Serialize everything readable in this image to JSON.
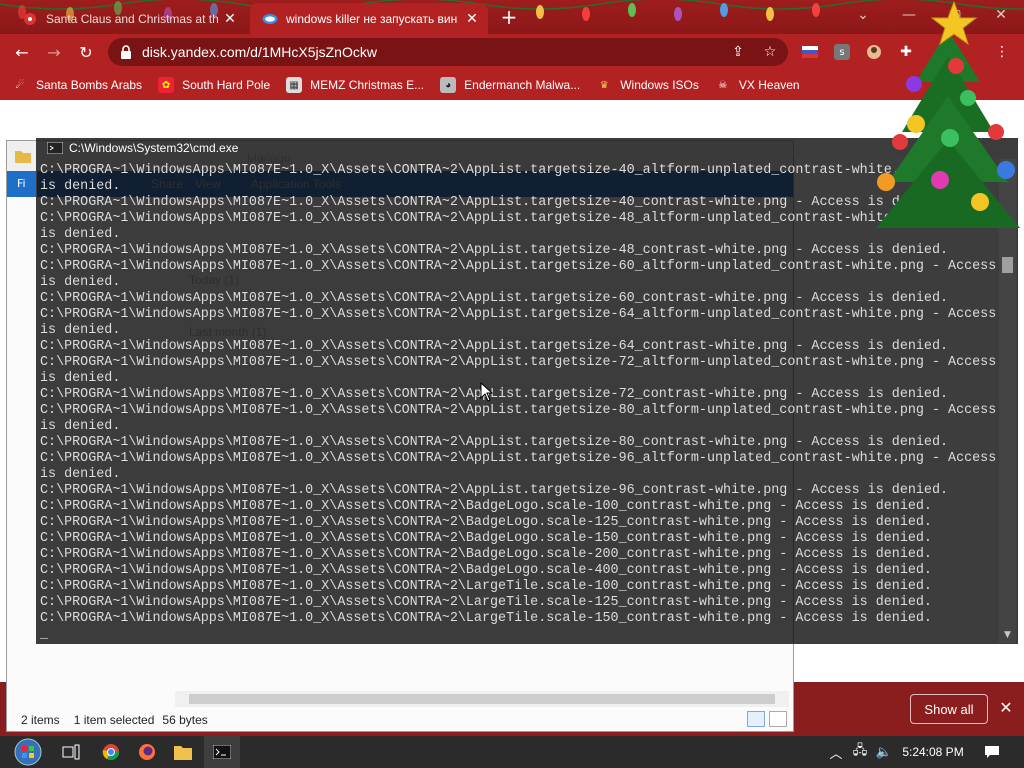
{
  "browser": {
    "tabs": [
      {
        "title": "Santa Claus and Christmas at th",
        "favicon": "christmas-icon"
      },
      {
        "title": "windows killer не запускать вин",
        "favicon": "disk-icon"
      }
    ],
    "active_tab": 1,
    "url": "disk.yandex.com/d/1MHcX5jsZnOckw",
    "bookmarks": [
      {
        "label": "Santa Bombs Arabs"
      },
      {
        "label": "South Hard Pole"
      },
      {
        "label": "MEMZ Christmas E..."
      },
      {
        "label": "Endermanch Malwa..."
      },
      {
        "label": "Windows ISOs"
      },
      {
        "label": "VX Heaven"
      }
    ],
    "extension_badge": "s",
    "download_bar": {
      "show_all": "Show all"
    }
  },
  "explorer": {
    "status": {
      "items": "2 items",
      "selected": "1 item selected",
      "size": "56 bytes"
    }
  },
  "cmd": {
    "title": "C:\\Windows\\System32\\cmd.exe",
    "lines": [
      "C:\\PROGRA~1\\WindowsApps\\MI087E~1.0_X\\Assets\\CONTRA~2\\AppList.targetsize-40_altform-unplated_contrast-white.png - Access",
      "is denied.",
      "C:\\PROGRA~1\\WindowsApps\\MI087E~1.0_X\\Assets\\CONTRA~2\\AppList.targetsize-40_contrast-white.png - Access is denied.",
      "C:\\PROGRA~1\\WindowsApps\\MI087E~1.0_X\\Assets\\CONTRA~2\\AppList.targetsize-48_altform-unplated_contrast-white.png - Access",
      "is denied.",
      "C:\\PROGRA~1\\WindowsApps\\MI087E~1.0_X\\Assets\\CONTRA~2\\AppList.targetsize-48_contrast-white.png - Access is denied.",
      "C:\\PROGRA~1\\WindowsApps\\MI087E~1.0_X\\Assets\\CONTRA~2\\AppList.targetsize-60_altform-unplated_contrast-white.png - Access",
      "is denied.",
      "C:\\PROGRA~1\\WindowsApps\\MI087E~1.0_X\\Assets\\CONTRA~2\\AppList.targetsize-60_contrast-white.png - Access is denied.",
      "C:\\PROGRA~1\\WindowsApps\\MI087E~1.0_X\\Assets\\CONTRA~2\\AppList.targetsize-64_altform-unplated_contrast-white.png - Access",
      "is denied.",
      "C:\\PROGRA~1\\WindowsApps\\MI087E~1.0_X\\Assets\\CONTRA~2\\AppList.targetsize-64_contrast-white.png - Access is denied.",
      "C:\\PROGRA~1\\WindowsApps\\MI087E~1.0_X\\Assets\\CONTRA~2\\AppList.targetsize-72_altform-unplated_contrast-white.png - Access",
      "is denied.",
      "C:\\PROGRA~1\\WindowsApps\\MI087E~1.0_X\\Assets\\CONTRA~2\\AppList.targetsize-72_contrast-white.png - Access is denied.",
      "C:\\PROGRA~1\\WindowsApps\\MI087E~1.0_X\\Assets\\CONTRA~2\\AppList.targetsize-80_altform-unplated_contrast-white.png - Access",
      "is denied.",
      "C:\\PROGRA~1\\WindowsApps\\MI087E~1.0_X\\Assets\\CONTRA~2\\AppList.targetsize-80_contrast-white.png - Access is denied.",
      "C:\\PROGRA~1\\WindowsApps\\MI087E~1.0_X\\Assets\\CONTRA~2\\AppList.targetsize-96_altform-unplated_contrast-white.png - Access",
      "is denied.",
      "C:\\PROGRA~1\\WindowsApps\\MI087E~1.0_X\\Assets\\CONTRA~2\\AppList.targetsize-96_contrast-white.png - Access is denied.",
      "C:\\PROGRA~1\\WindowsApps\\MI087E~1.0_X\\Assets\\CONTRA~2\\BadgeLogo.scale-100_contrast-white.png - Access is denied.",
      "C:\\PROGRA~1\\WindowsApps\\MI087E~1.0_X\\Assets\\CONTRA~2\\BadgeLogo.scale-125_contrast-white.png - Access is denied.",
      "C:\\PROGRA~1\\WindowsApps\\MI087E~1.0_X\\Assets\\CONTRA~2\\BadgeLogo.scale-150_contrast-white.png - Access is denied.",
      "C:\\PROGRA~1\\WindowsApps\\MI087E~1.0_X\\Assets\\CONTRA~2\\BadgeLogo.scale-200_contrast-white.png - Access is denied.",
      "C:\\PROGRA~1\\WindowsApps\\MI087E~1.0_X\\Assets\\CONTRA~2\\BadgeLogo.scale-400_contrast-white.png - Access is denied.",
      "C:\\PROGRA~1\\WindowsApps\\MI087E~1.0_X\\Assets\\CONTRA~2\\LargeTile.scale-100_contrast-white.png - Access is denied.",
      "C:\\PROGRA~1\\WindowsApps\\MI087E~1.0_X\\Assets\\CONTRA~2\\LargeTile.scale-125_contrast-white.png - Access is denied.",
      "C:\\PROGRA~1\\WindowsApps\\MI087E~1.0_X\\Assets\\CONTRA~2\\LargeTile.scale-150_contrast-white.png - Access is denied.",
      "_"
    ]
  },
  "taskbar": {
    "clock": "5:24:08 PM",
    "apps": [
      "start-orb-icon",
      "task-view-icon",
      "chrome-icon",
      "firefox-icon",
      "explorer-icon",
      "cmd-icon"
    ]
  },
  "colors": {
    "browser_frame": "#8b1818",
    "toolbar": "#b32222",
    "cmd_text": "#dcdcdc",
    "explorer_accent": "#1e6fc8"
  }
}
